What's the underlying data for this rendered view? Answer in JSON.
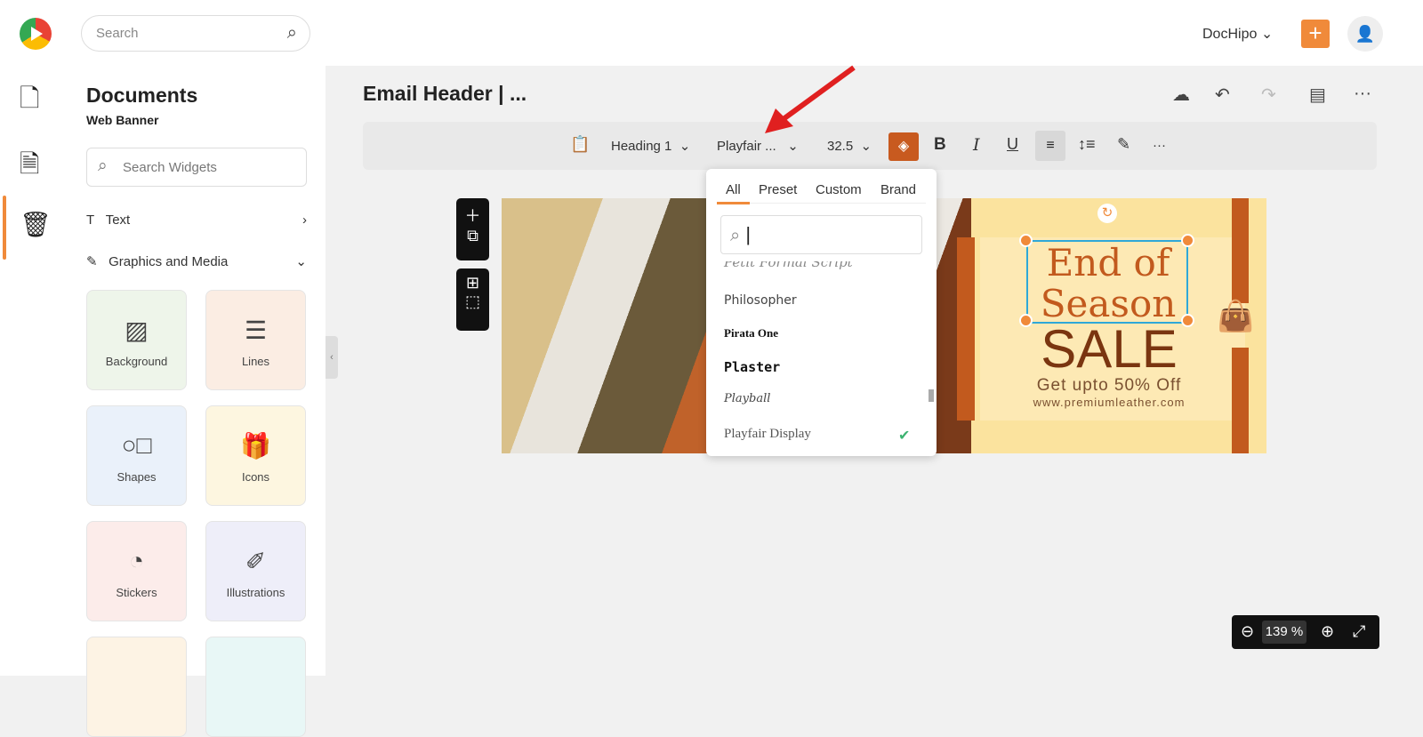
{
  "topbar": {
    "search_placeholder": "Search",
    "brand": "DocHipo",
    "brand_chevron": "⌄",
    "add": "+",
    "user_icon": "👤"
  },
  "sidebar": {
    "title": "Documents",
    "subtitle": "Web Banner",
    "search_placeholder": "Search Widgets",
    "categories": [
      {
        "label": "Text",
        "chevron": "›"
      },
      {
        "label": "Graphics and Media",
        "chevron": "⌄"
      }
    ],
    "widgets": [
      {
        "label": "Background",
        "bg": "#eef5ea"
      },
      {
        "label": "Lines",
        "bg": "#fbede3"
      },
      {
        "label": "Shapes",
        "bg": "#eaf1fa"
      },
      {
        "label": "Icons",
        "bg": "#fdf6e0"
      },
      {
        "label": "Stickers",
        "bg": "#fcecea"
      },
      {
        "label": "Illustrations",
        "bg": "#eeeef9"
      }
    ]
  },
  "document": {
    "title": "Email Header | ..."
  },
  "toolbar": {
    "style": "Heading 1",
    "font": "Playfair ...",
    "size": "32.5",
    "bold": "B",
    "italic": "I",
    "underline": "U",
    "more": "···"
  },
  "font_dropdown": {
    "tabs": [
      "All",
      "Preset",
      "Custom",
      "Brand"
    ],
    "active_tab": "All",
    "search_value": "|",
    "fonts": [
      {
        "name": "Petit Formal Script"
      },
      {
        "name": "Philosopher"
      },
      {
        "name": "Pirata One"
      },
      {
        "name": "Plaster"
      },
      {
        "name": "Playball"
      },
      {
        "name": "Playfair Display",
        "selected": true
      }
    ],
    "check": "✔"
  },
  "banner": {
    "headline": "End of Season",
    "sale": "SALE",
    "offer": "Get upto 50% Off",
    "url": "www.premiumleather.com"
  },
  "zoom": {
    "value": "139 %"
  },
  "colors": {
    "accent": "#f08a3a",
    "fill": "#c85a1f",
    "banner_bg": "#fbe39e",
    "banner_bar": "#c25a1e"
  }
}
